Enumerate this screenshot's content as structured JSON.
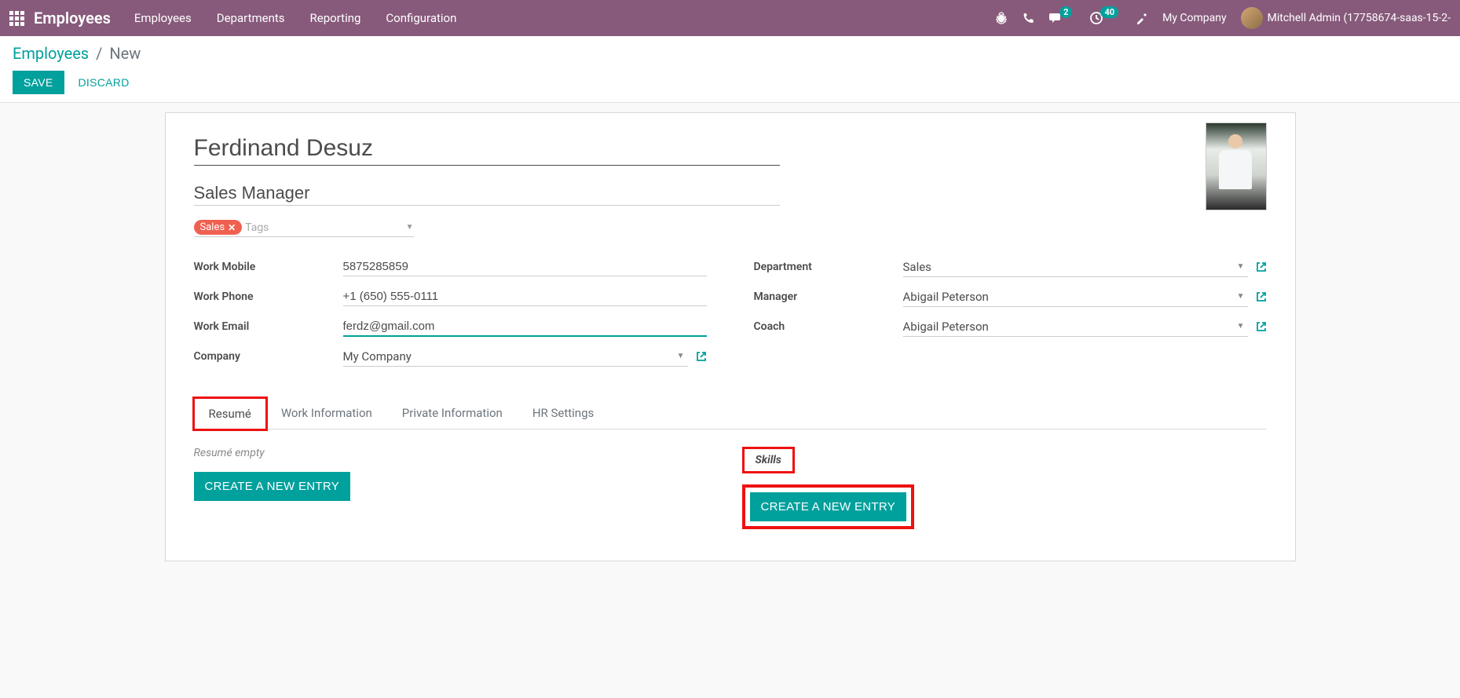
{
  "topbar": {
    "brand": "Employees",
    "menu": [
      "Employees",
      "Departments",
      "Reporting",
      "Configuration"
    ],
    "messages_badge": "2",
    "activities_badge": "40",
    "company": "My Company",
    "user": "Mitchell Admin (17758674-saas-15-2-"
  },
  "breadcrumb": {
    "root": "Employees",
    "current": "New"
  },
  "actions": {
    "save": "SAVE",
    "discard": "DISCARD"
  },
  "form": {
    "name": "Ferdinand Desuz",
    "title": "Sales Manager",
    "tags": [
      "Sales"
    ],
    "tags_placeholder": "Tags",
    "left": {
      "work_mobile": {
        "label": "Work Mobile",
        "value": "5875285859"
      },
      "work_phone": {
        "label": "Work Phone",
        "value": "+1 (650) 555-0111"
      },
      "work_email": {
        "label": "Work Email",
        "value": "ferdz@gmail.com"
      },
      "company": {
        "label": "Company",
        "value": "My Company"
      }
    },
    "right": {
      "department": {
        "label": "Department",
        "value": "Sales"
      },
      "manager": {
        "label": "Manager",
        "value": "Abigail Peterson"
      },
      "coach": {
        "label": "Coach",
        "value": "Abigail Peterson"
      }
    }
  },
  "tabs": [
    "Resumé",
    "Work Information",
    "Private Information",
    "HR Settings"
  ],
  "resume": {
    "empty": "Resumé empty",
    "create": "CREATE A NEW ENTRY",
    "skills_heading": "Skills",
    "skills_create": "CREATE A NEW ENTRY"
  }
}
